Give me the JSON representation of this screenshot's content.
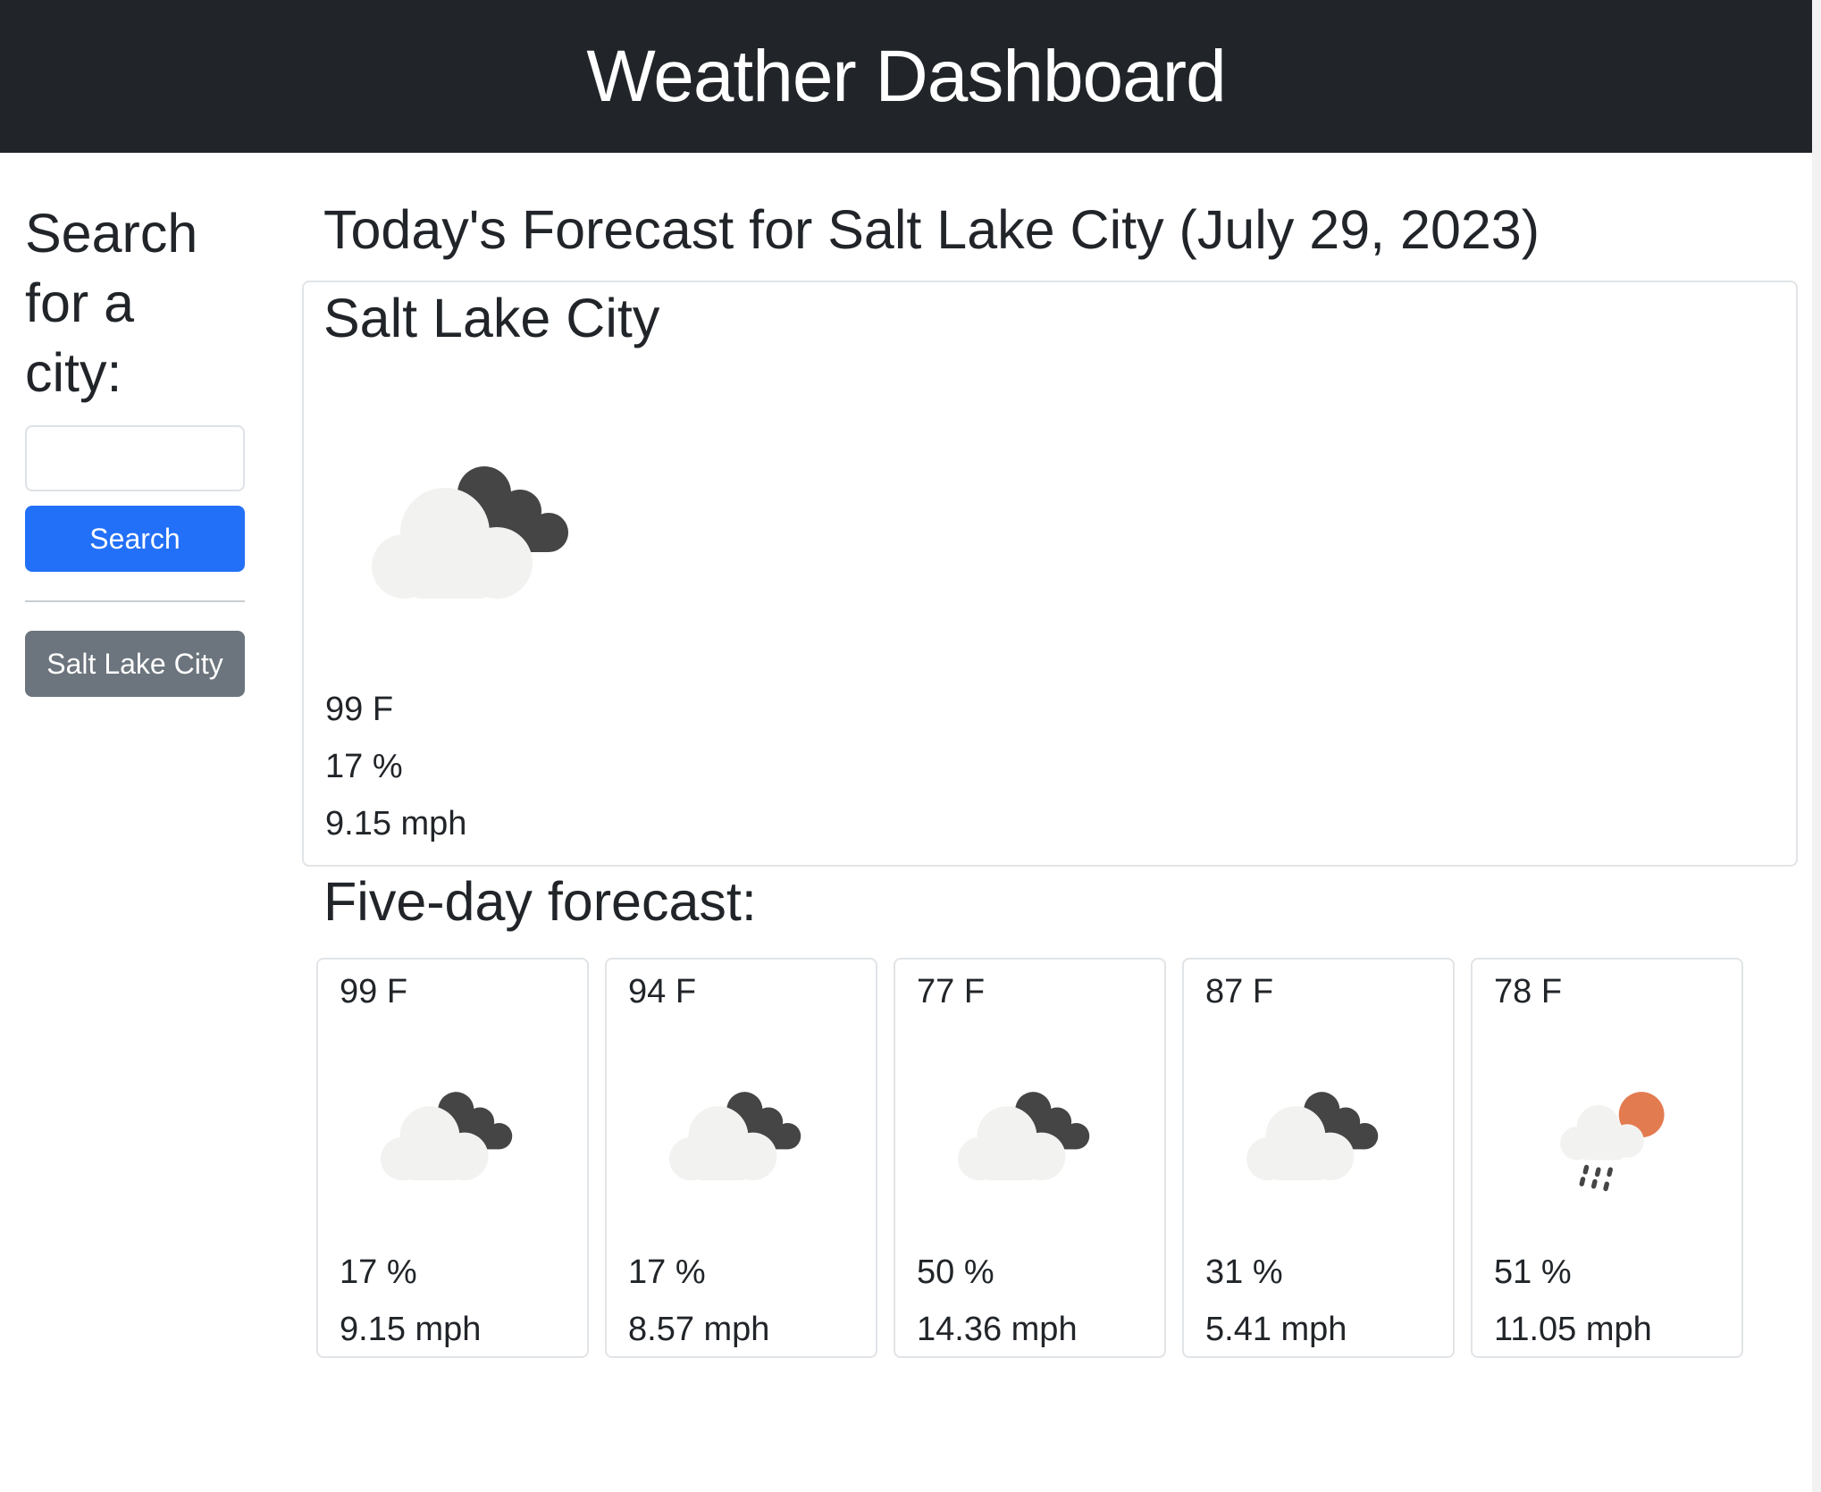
{
  "header": {
    "title": "Weather Dashboard"
  },
  "sidebar": {
    "heading": "Search for a city:",
    "search_value": "",
    "search_button_label": "Search",
    "history": [
      "Salt Lake City"
    ]
  },
  "today": {
    "heading": "Today's Forecast for Salt Lake City (July 29, 2023)",
    "city": "Salt Lake City",
    "icon": "partly-cloudy-dark-icon",
    "temperature": "99 F",
    "humidity": "17 %",
    "wind": "9.15 mph"
  },
  "five_day": {
    "heading": "Five-day forecast:",
    "days": [
      {
        "temperature": "99 F",
        "icon": "partly-cloudy-dark-icon",
        "humidity": "17 %",
        "wind": "9.15 mph"
      },
      {
        "temperature": "94 F",
        "icon": "partly-cloudy-dark-icon",
        "humidity": "17 %",
        "wind": "8.57 mph"
      },
      {
        "temperature": "77 F",
        "icon": "partly-cloudy-dark-icon",
        "humidity": "50 %",
        "wind": "14.36 mph"
      },
      {
        "temperature": "87 F",
        "icon": "partly-cloudy-dark-icon",
        "humidity": "31 %",
        "wind": "5.41 mph"
      },
      {
        "temperature": "78 F",
        "icon": "sun-rain-icon",
        "humidity": "51 %",
        "wind": "11.05 mph"
      }
    ]
  },
  "colors": {
    "header_bg": "#212529",
    "primary": "#2370f8",
    "secondary": "#6c757d",
    "sun": "#e37b50"
  }
}
